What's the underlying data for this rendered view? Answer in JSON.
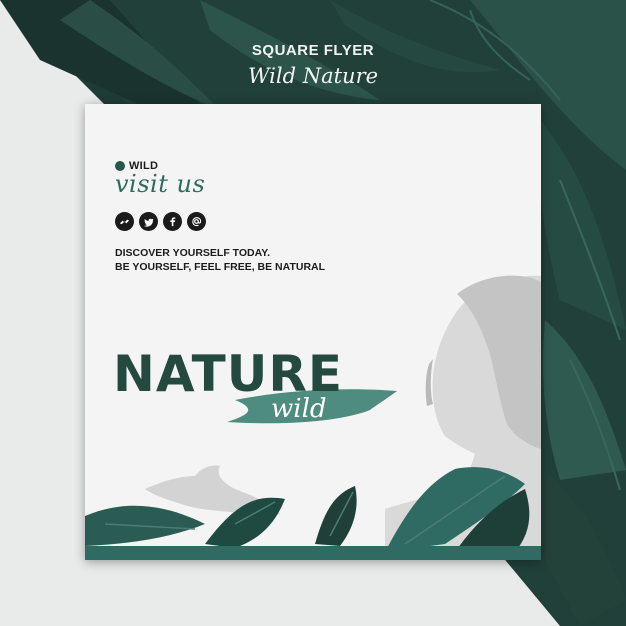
{
  "header": {
    "title": "SQUARE FLYER",
    "subtitle": "Wild Nature"
  },
  "flyer": {
    "brand": "WILD",
    "script_heading": "visit us",
    "social_icons": [
      "messenger-icon",
      "twitter-icon",
      "facebook-icon",
      "at-sign-icon"
    ],
    "tagline_lines": [
      "DISCOVER YOURSELF TODAY.",
      "BE YOURSELF, FEEL FREE, BE NATURAL"
    ],
    "headline": "NATURE",
    "headline_script": "wild"
  },
  "colors": {
    "backdrop_dark": "#1f3b35",
    "accent_green": "#2f6b5d",
    "brush_teal": "#4f8c80",
    "card_background": "#f4f4f4"
  }
}
